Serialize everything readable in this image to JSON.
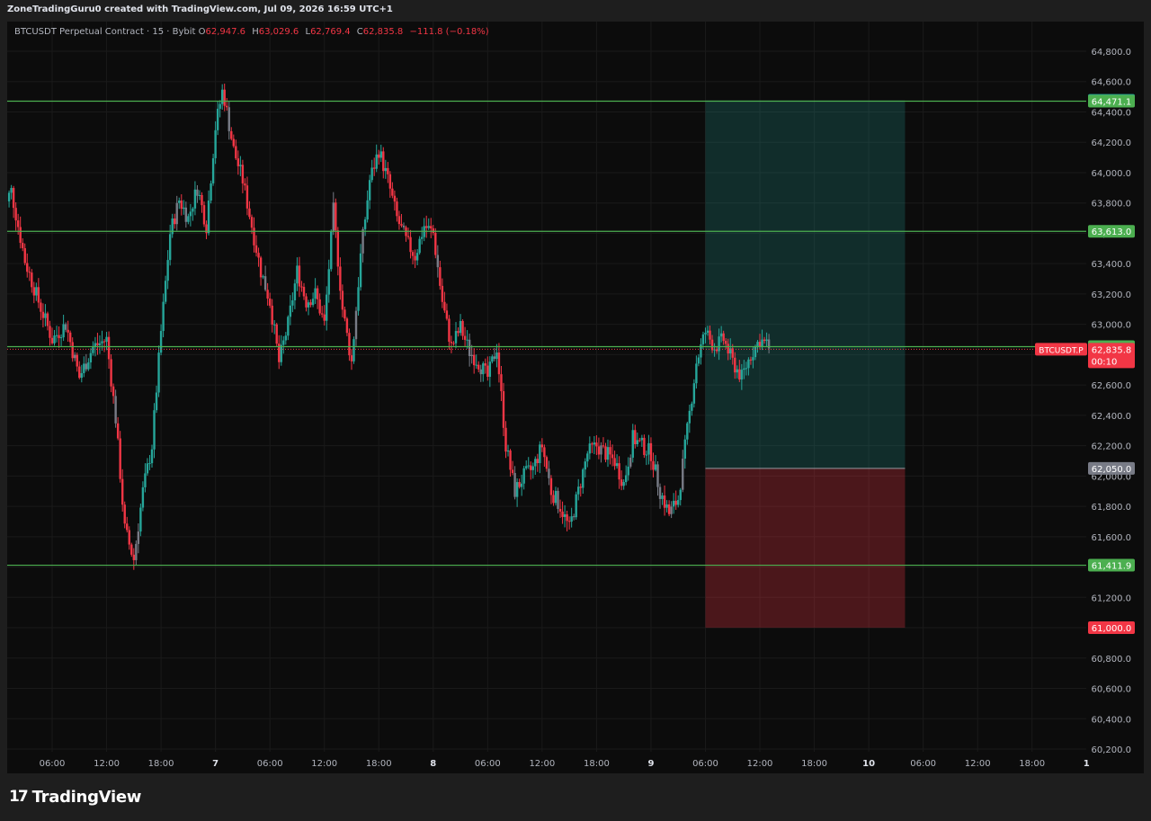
{
  "header": {
    "credit": "ZoneTradingGuru0 created with TradingView.com, Jul 09, 2026 16:59 UTC+1"
  },
  "legend": {
    "symbol": "BTCUSDT Perpetual Contract · 15 · Bybit",
    "o_label": "O",
    "o_value": "62,947.6",
    "h_label": "H",
    "h_value": "63,029.6",
    "l_label": "L",
    "l_value": "62,769.4",
    "c_label": "C",
    "c_value": "62,835.8",
    "change": "−111.8 (−0.18%)"
  },
  "logo": {
    "mark": "17",
    "text": "TradingView"
  },
  "colors": {
    "up": "#26a69a",
    "down": "#f23645",
    "level": "#4caf50",
    "profit_zone": "rgba(38,166,154,0.22)",
    "loss_zone": "rgba(242,54,69,0.28)",
    "background": "#0c0c0c",
    "grid": "#1a1a1a"
  },
  "chart_data": {
    "type": "candlestick",
    "symbol": "BTCUSDT.P",
    "timeframe": "15",
    "ylim": [
      60100,
      64950
    ],
    "y_ticks": [
      60200,
      60400,
      60600,
      60800,
      61000,
      61200,
      61400,
      61600,
      61800,
      62000,
      62200,
      62400,
      62600,
      62800,
      63000,
      63200,
      63400,
      63600,
      63800,
      64000,
      64200,
      64400,
      64600,
      64800
    ],
    "y_tick_labels": [
      "60,200.0",
      "60,400.0",
      "60,600.0",
      "60,800.0",
      "61,000.0",
      "61,200.0",
      "61,400.0",
      "61,600.0",
      "61,800.0",
      "62,000.0",
      "62,200.0",
      "62,400.0",
      "62,600.0",
      "62,800.0",
      "63,000.0",
      "63,200.0",
      "63,400.0",
      "63,600.0",
      "63,800.0",
      "64,000.0",
      "64,200.0",
      "64,400.0",
      "64,600.0",
      "64,800.0"
    ],
    "x_ticks": [
      "06:00",
      "12:00",
      "18:00",
      "7",
      "06:00",
      "12:00",
      "18:00",
      "8",
      "06:00",
      "12:00",
      "18:00",
      "9",
      "06:00",
      "12:00",
      "18:00",
      "10",
      "06:00",
      "12:00",
      "18:00",
      "1"
    ],
    "x_tick_hours": [
      6,
      12,
      18,
      24,
      30,
      36,
      42,
      48,
      54,
      60,
      66,
      72,
      78,
      84,
      90,
      96,
      102,
      108,
      114,
      120
    ],
    "bold_x_ticks": [
      3,
      7,
      11,
      15,
      19
    ],
    "path": [
      [
        0,
        63700
      ],
      [
        1.5,
        63880
      ],
      [
        3,
        63420
      ],
      [
        4.5,
        63150
      ],
      [
        6,
        62900
      ],
      [
        7.5,
        63000
      ],
      [
        9,
        62650
      ],
      [
        10.5,
        62850
      ],
      [
        12,
        62900
      ],
      [
        13,
        62380
      ],
      [
        14,
        61650
      ],
      [
        15,
        61450
      ],
      [
        16,
        61900
      ],
      [
        17,
        62200
      ],
      [
        18,
        62950
      ],
      [
        19,
        63600
      ],
      [
        20,
        63820
      ],
      [
        21,
        63700
      ],
      [
        22,
        63900
      ],
      [
        23,
        63650
      ],
      [
        24,
        64300
      ],
      [
        24.8,
        64550
      ],
      [
        26,
        64150
      ],
      [
        27,
        63950
      ],
      [
        28,
        63650
      ],
      [
        29,
        63350
      ],
      [
        30,
        63150
      ],
      [
        31,
        62750
      ],
      [
        32,
        63000
      ],
      [
        33,
        63350
      ],
      [
        34,
        63150
      ],
      [
        35,
        63200
      ],
      [
        36,
        63000
      ],
      [
        37,
        63750
      ],
      [
        38,
        63100
      ],
      [
        39,
        62750
      ],
      [
        40,
        63450
      ],
      [
        41,
        63950
      ],
      [
        42,
        64150
      ],
      [
        43,
        63950
      ],
      [
        44,
        63700
      ],
      [
        45,
        63550
      ],
      [
        46,
        63450
      ],
      [
        47,
        63650
      ],
      [
        48,
        63600
      ],
      [
        49,
        63150
      ],
      [
        50,
        62850
      ],
      [
        51,
        62980
      ],
      [
        52,
        62820
      ],
      [
        53,
        62750
      ],
      [
        54,
        62650
      ],
      [
        55,
        62850
      ],
      [
        56,
        62200
      ],
      [
        57,
        61900
      ],
      [
        58,
        62000
      ],
      [
        59,
        62050
      ],
      [
        60,
        62200
      ],
      [
        61,
        61900
      ],
      [
        62,
        61800
      ],
      [
        63,
        61650
      ],
      [
        64,
        61900
      ],
      [
        65,
        62150
      ],
      [
        66,
        62200
      ],
      [
        67,
        62150
      ],
      [
        68,
        62100
      ],
      [
        69,
        61950
      ],
      [
        70,
        62250
      ],
      [
        71,
        62200
      ],
      [
        72,
        62150
      ],
      [
        73,
        61900
      ],
      [
        74,
        61750
      ],
      [
        75,
        61850
      ],
      [
        76,
        62300
      ],
      [
        77,
        62750
      ],
      [
        78,
        62950
      ],
      [
        79,
        62850
      ],
      [
        80,
        62900
      ],
      [
        81,
        62750
      ],
      [
        82,
        62650
      ],
      [
        83,
        62800
      ],
      [
        84,
        62900
      ],
      [
        85,
        62850
      ]
    ],
    "levels": [
      {
        "price": 64471.1,
        "label": "64,471.1",
        "color": "#4caf50"
      },
      {
        "price": 63613.0,
        "label": "63,613.0",
        "color": "#4caf50"
      },
      {
        "price": 62852.8,
        "label": "62,852.8",
        "color": "#4caf50"
      },
      {
        "price": 61411.9,
        "label": "61,411.9",
        "color": "#4caf50"
      }
    ],
    "position": {
      "type": "long",
      "start_hour": 78,
      "end_hour": 100,
      "entry": 62050.0,
      "entry_label": "62,050.0",
      "target": 64476.5,
      "target_label": "64,476.5",
      "stop": 61000.0,
      "stop_label": "61,000.0"
    },
    "last_price": {
      "symbol": "BTCUSDT.P",
      "value": 62835.8,
      "label": "62,835.8",
      "countdown": "00:10"
    }
  }
}
